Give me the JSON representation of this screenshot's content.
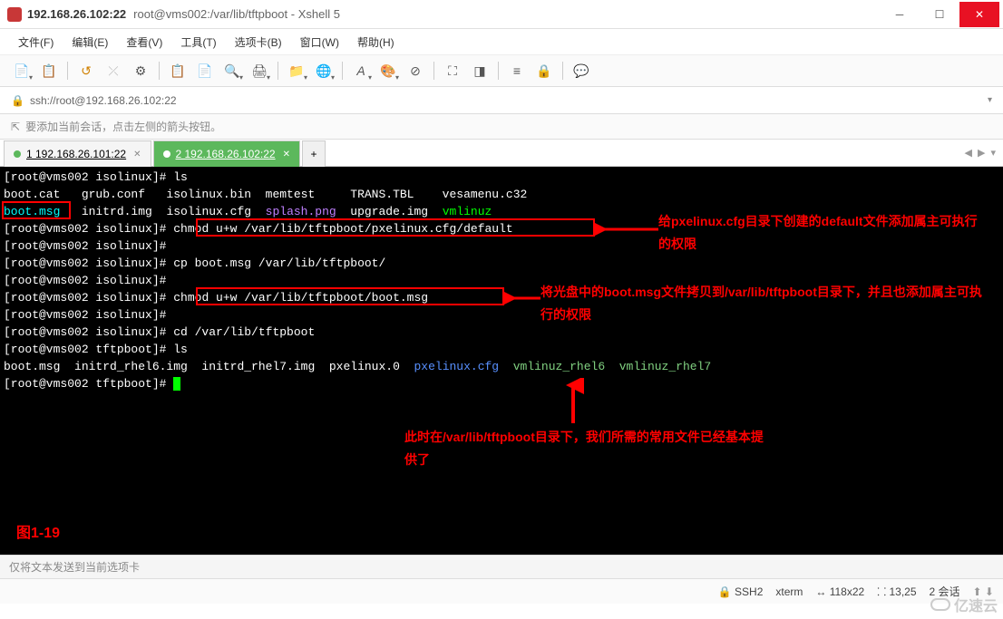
{
  "titlebar": {
    "host": "192.168.26.102:22",
    "subtitle": "root@vms002:/var/lib/tftpboot - Xshell 5"
  },
  "menu": {
    "file": "文件(F)",
    "edit": "编辑(E)",
    "view": "查看(V)",
    "tools": "工具(T)",
    "tabs": "选项卡(B)",
    "window": "窗口(W)",
    "help": "帮助(H)"
  },
  "address": {
    "url": "ssh://root@192.168.26.102:22"
  },
  "hint": {
    "text": "要添加当前会话，点击左侧的箭头按钮。"
  },
  "tabs": {
    "tab1": "1 192.168.26.101:22",
    "tab2": "2 192.168.26.102:22",
    "add": "+"
  },
  "terminal": {
    "lines": [
      {
        "seg": [
          {
            "t": "[root@vms002 isolinux]# ls",
            "c": ""
          }
        ]
      },
      {
        "seg": [
          {
            "t": "boot.cat   grub.conf   isolinux.bin  memtest     TRANS.TBL    vesamenu.c32",
            "c": ""
          }
        ]
      },
      {
        "seg": [
          {
            "t": "boot.msg",
            "c": "c-cyan"
          },
          {
            "t": "   initrd.img  isolinux.cfg  ",
            "c": ""
          },
          {
            "t": "splash.png",
            "c": "c-purple"
          },
          {
            "t": "  upgrade.img  ",
            "c": ""
          },
          {
            "t": "vmlinuz",
            "c": "c-green"
          }
        ]
      },
      {
        "seg": [
          {
            "t": "[root@vms002 isolinux]# ",
            "c": ""
          },
          {
            "t": "chmod u+w /var/lib/tftpboot/pxelinux.cfg/default",
            "c": ""
          }
        ]
      },
      {
        "seg": [
          {
            "t": "[root@vms002 isolinux]# ",
            "c": ""
          }
        ]
      },
      {
        "seg": [
          {
            "t": "[root@vms002 isolinux]# cp boot.msg /var/lib/tftpboot/",
            "c": ""
          }
        ]
      },
      {
        "seg": [
          {
            "t": "[root@vms002 isolinux]# ",
            "c": ""
          }
        ]
      },
      {
        "seg": [
          {
            "t": "[root@vms002 isolinux]# ",
            "c": ""
          },
          {
            "t": "chmod u+w /var/lib/tftpboot/boot.msg",
            "c": ""
          }
        ]
      },
      {
        "seg": [
          {
            "t": "[root@vms002 isolinux]# ",
            "c": ""
          }
        ]
      },
      {
        "seg": [
          {
            "t": "[root@vms002 isolinux]# cd /var/lib/tftpboot",
            "c": ""
          }
        ]
      },
      {
        "seg": [
          {
            "t": "[root@vms002 tftpboot]# ls",
            "c": ""
          }
        ]
      },
      {
        "seg": [
          {
            "t": "boot.msg  initrd_rhel6.img  initrd_rhel7.img  pxelinux.0  ",
            "c": ""
          },
          {
            "t": "pxelinux.cfg",
            "c": "c-blue"
          },
          {
            "t": "  ",
            "c": ""
          },
          {
            "t": "vmlinuz_rhel6",
            "c": "c-lgreen"
          },
          {
            "t": "  ",
            "c": ""
          },
          {
            "t": "vmlinuz_rhel7",
            "c": "c-lgreen"
          }
        ]
      },
      {
        "seg": [
          {
            "t": "[root@vms002 tftpboot]# ",
            "c": ""
          }
        ],
        "cursor": true
      }
    ]
  },
  "annotations": {
    "note1": "给pxelinux.cfg目录下创建的default文件添加属主可执行的权限",
    "note2": "将光盘中的boot.msg文件拷贝到/var/lib/tftpboot目录下，并且也添加属主可执行的权限",
    "note3": "此时在/var/lib/tftpboot目录下，我们所需的常用文件已经基本提供了",
    "figlabel": "图1-19"
  },
  "footer": {
    "hint": "仅将文本发送到当前选项卡"
  },
  "status": {
    "proto": "SSH2",
    "term": "xterm",
    "size": "118x22",
    "pos": "13,25",
    "sessions": "2 会话"
  },
  "watermark": "亿速云"
}
